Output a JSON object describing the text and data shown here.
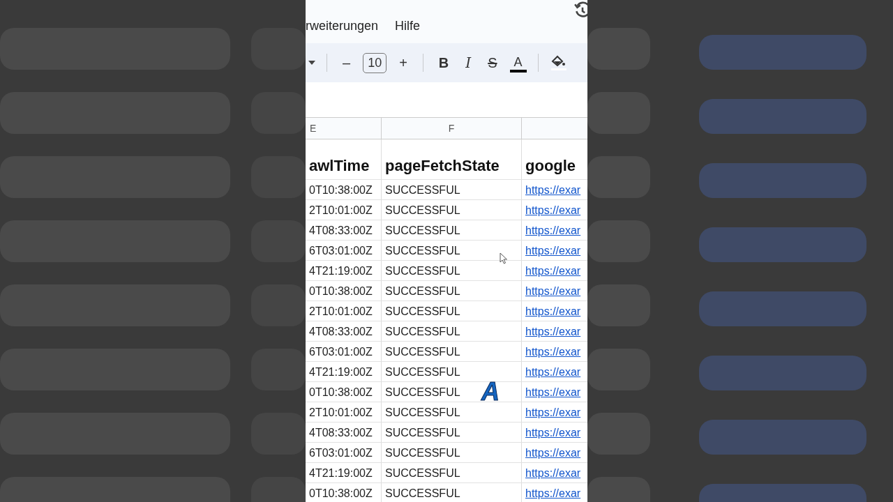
{
  "menu": [
    "rweiterungen",
    "Hilfe"
  ],
  "toolbar": {
    "decrease": "–",
    "font_size": "10",
    "increase": "+",
    "bold": "B",
    "italic": "I",
    "strike": "S",
    "text_color": "A"
  },
  "column_headers": [
    "E",
    "F"
  ],
  "header_row": [
    "awlTime",
    "pageFetchState",
    "google"
  ],
  "rows": [
    [
      "0T10:38:00Z",
      "SUCCESSFUL",
      "https://exar"
    ],
    [
      "2T10:01:00Z",
      "SUCCESSFUL",
      "https://exar"
    ],
    [
      "4T08:33:00Z",
      "SUCCESSFUL",
      "https://exar"
    ],
    [
      "6T03:01:00Z",
      "SUCCESSFUL",
      "https://exar"
    ],
    [
      "4T21:19:00Z",
      "SUCCESSFUL",
      "https://exar"
    ],
    [
      "0T10:38:00Z",
      "SUCCESSFUL",
      "https://exar"
    ],
    [
      "2T10:01:00Z",
      "SUCCESSFUL",
      "https://exar"
    ],
    [
      "4T08:33:00Z",
      "SUCCESSFUL",
      "https://exar"
    ],
    [
      "6T03:01:00Z",
      "SUCCESSFUL",
      "https://exar"
    ],
    [
      "4T21:19:00Z",
      "SUCCESSFUL",
      "https://exar"
    ],
    [
      "0T10:38:00Z",
      "SUCCESSFUL",
      "https://exar"
    ],
    [
      "2T10:01:00Z",
      "SUCCESSFUL",
      "https://exar"
    ],
    [
      "4T08:33:00Z",
      "SUCCESSFUL",
      "https://exar"
    ],
    [
      "6T03:01:00Z",
      "SUCCESSFUL",
      "https://exar"
    ],
    [
      "4T21:19:00Z",
      "SUCCESSFUL",
      "https://exar"
    ],
    [
      "0T10:38:00Z",
      "SUCCESSFUL",
      "https://exar"
    ]
  ],
  "caption": "A"
}
